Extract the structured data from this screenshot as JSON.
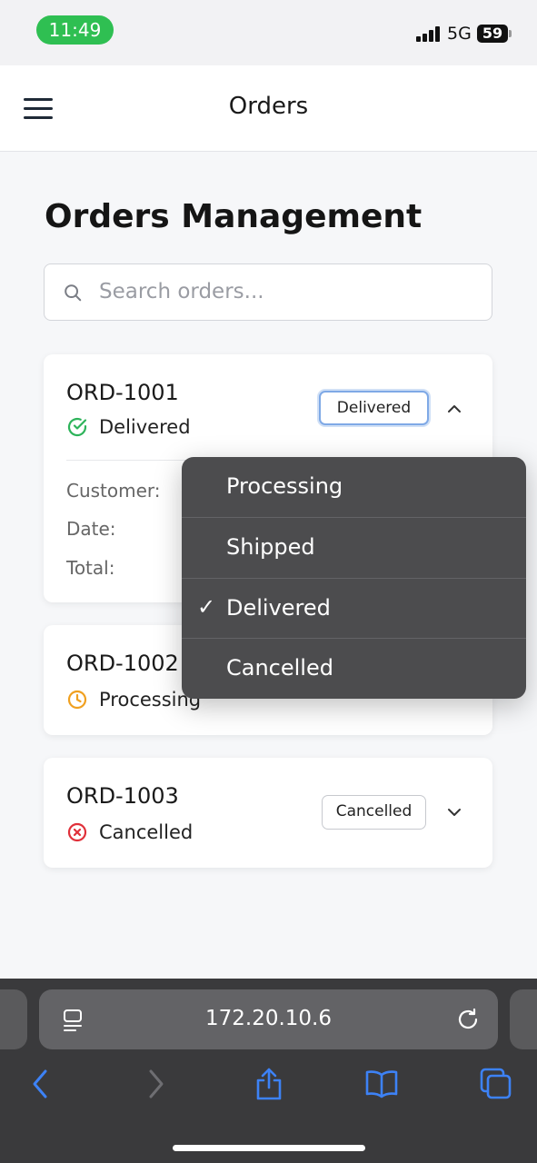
{
  "status_bar": {
    "time": "11:49",
    "network": "5G",
    "battery": "59"
  },
  "header": {
    "title": "Orders"
  },
  "page": {
    "title": "Orders Management"
  },
  "search": {
    "placeholder": "Search orders..."
  },
  "orders": [
    {
      "id": "ORD-1001",
      "status": "Delivered",
      "select_value": "Delivered",
      "expanded": true,
      "details": {
        "customer_label": "Customer:",
        "date_label": "Date:",
        "total_label": "Total:"
      }
    },
    {
      "id": "ORD-1002",
      "status": "Processing",
      "expanded": false
    },
    {
      "id": "ORD-1003",
      "status": "Cancelled",
      "select_value": "Cancelled",
      "expanded": false
    }
  ],
  "status_colors": {
    "Delivered": "#2db35a",
    "Processing": "#f0a020",
    "Cancelled": "#e0303a"
  },
  "dropdown": {
    "options": [
      "Processing",
      "Shipped",
      "Delivered",
      "Cancelled"
    ],
    "selected": "Delivered",
    "check_glyph": "✓"
  },
  "browser": {
    "url": "172.20.10.6",
    "accent": "#3d82f6"
  }
}
